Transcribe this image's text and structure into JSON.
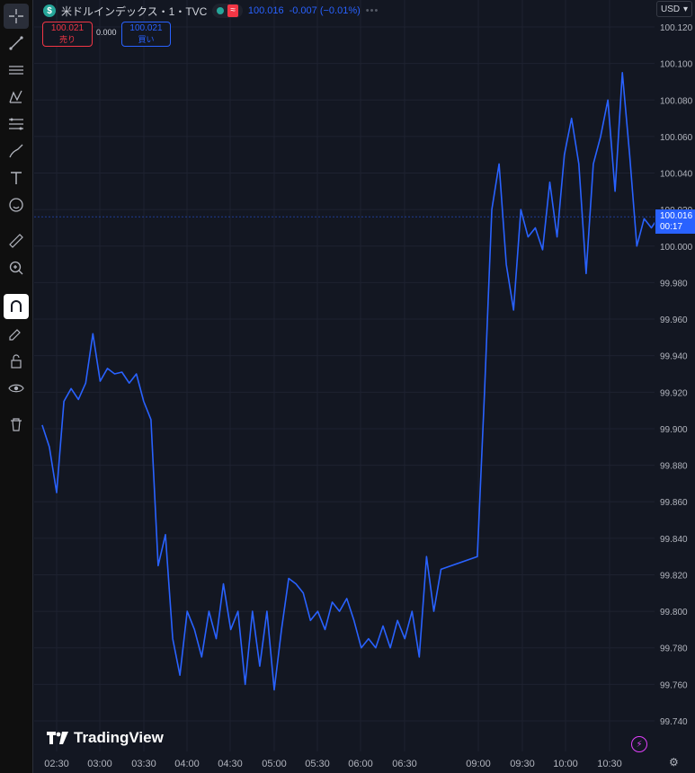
{
  "header": {
    "symbol_title": "米ドルインデックス・1・TVC",
    "badge": "$",
    "last_price": "100.016",
    "change": "-0.007 (−0.01%)",
    "more": "•••",
    "wave": "≈"
  },
  "trade": {
    "sell_price": "100.021",
    "sell_label": "売り",
    "spread": "0.000",
    "buy_price": "100.021",
    "buy_label": "買い"
  },
  "currency": {
    "label": "USD",
    "arrow": "▾"
  },
  "price_tag": {
    "price": "100.016",
    "countdown": "00:17"
  },
  "branding": {
    "name": "TradingView"
  },
  "toolbar_icons": [
    "crosshair-icon",
    "trend-line-icon",
    "horizontal-lines-icon",
    "pattern-icon",
    "fib-icon",
    "brush-icon",
    "text-icon",
    "emoji-icon",
    "ruler-icon",
    "zoom-in-icon",
    "magnet-icon",
    "lock-pencil-icon",
    "unlock-icon",
    "eye-icon",
    "trash-icon"
  ],
  "colors": {
    "line": "#2962ff",
    "background": "#131722",
    "accent_sell": "#f23645",
    "accent_buy": "#2962ff"
  },
  "chart_data": {
    "type": "line",
    "ylim": [
      99.73,
      100.125
    ],
    "y_ticks": [
      "100.120",
      "100.100",
      "100.080",
      "100.060",
      "100.040",
      "100.020",
      "100.000",
      "99.980",
      "99.960",
      "99.940",
      "99.920",
      "99.900",
      "99.880",
      "99.860",
      "99.840",
      "99.820",
      "99.800",
      "99.780",
      "99.760",
      "99.740"
    ],
    "x_ticks": [
      "02:30",
      "03:00",
      "03:30",
      "04:00",
      "04:30",
      "05:00",
      "05:30",
      "06:00",
      "06:30",
      "09:00",
      "09:30",
      "10:00",
      "10:30"
    ],
    "current_price": 100.016,
    "x": [
      "02:20",
      "02:25",
      "02:30",
      "02:35",
      "02:40",
      "02:45",
      "02:50",
      "02:55",
      "03:00",
      "03:05",
      "03:10",
      "03:15",
      "03:20",
      "03:25",
      "03:30",
      "03:35",
      "03:40",
      "03:45",
      "03:50",
      "03:55",
      "04:00",
      "04:05",
      "04:10",
      "04:15",
      "04:20",
      "04:25",
      "04:30",
      "04:35",
      "04:40",
      "04:45",
      "04:50",
      "04:55",
      "05:00",
      "05:05",
      "05:10",
      "05:15",
      "05:20",
      "05:25",
      "05:30",
      "05:35",
      "05:40",
      "05:45",
      "05:50",
      "05:55",
      "06:00",
      "06:05",
      "06:10",
      "06:15",
      "06:20",
      "06:25",
      "06:30",
      "06:35",
      "06:40",
      "06:45",
      "06:50",
      "06:55",
      "08:30",
      "08:35",
      "08:40",
      "08:45",
      "08:50",
      "08:55",
      "09:00",
      "09:05",
      "09:10",
      "09:15",
      "09:20",
      "09:25",
      "09:30",
      "09:35",
      "09:40",
      "09:45",
      "09:50",
      "09:55",
      "10:00",
      "10:05",
      "10:10",
      "10:15",
      "10:20",
      "10:25",
      "10:30",
      "10:35",
      "10:40",
      "10:45"
    ],
    "values": [
      99.902,
      99.89,
      99.865,
      99.915,
      99.922,
      99.916,
      99.925,
      99.952,
      99.926,
      99.933,
      99.93,
      99.931,
      99.925,
      99.93,
      99.915,
      99.905,
      99.825,
      99.842,
      99.785,
      99.765,
      99.8,
      99.79,
      99.775,
      99.8,
      99.785,
      99.815,
      99.79,
      99.8,
      99.76,
      99.8,
      99.77,
      99.8,
      99.757,
      99.79,
      99.818,
      99.815,
      99.81,
      99.795,
      99.8,
      99.79,
      99.805,
      99.8,
      99.807,
      99.795,
      99.78,
      99.785,
      99.78,
      99.792,
      99.78,
      99.795,
      99.785,
      99.8,
      99.775,
      99.83,
      99.8,
      99.823,
      99.83,
      99.92,
      100.02,
      100.045,
      99.99,
      99.965,
      100.02,
      100.005,
      100.01,
      99.998,
      100.035,
      100.005,
      100.05,
      100.07,
      100.045,
      99.985,
      100.045,
      100.06,
      100.08,
      100.03,
      100.095,
      100.05,
      100.0,
      100.015,
      100.01,
      100.016,
      100.016,
      100.016
    ]
  }
}
